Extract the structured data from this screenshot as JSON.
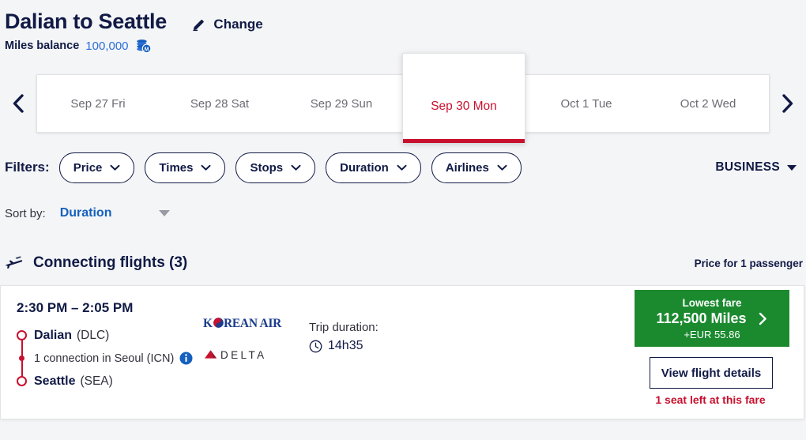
{
  "header": {
    "route_title": "Dalian to Seattle",
    "change_label": "Change",
    "miles_label": "Miles balance",
    "miles_value": "100,000"
  },
  "date_strip": {
    "prev_label": "previous dates",
    "next_label": "next dates",
    "tabs": [
      {
        "label": "Sep 27 Fri",
        "selected": false
      },
      {
        "label": "Sep 28 Sat",
        "selected": false
      },
      {
        "label": "Sep 29 Sun",
        "selected": false
      },
      {
        "label": "Sep 30 Mon",
        "selected": true
      },
      {
        "label": "Oct 1 Tue",
        "selected": false
      },
      {
        "label": "Oct 2 Wed",
        "selected": false
      }
    ]
  },
  "filters": {
    "label": "Filters:",
    "pills": [
      {
        "label": "Price"
      },
      {
        "label": "Times"
      },
      {
        "label": "Stops"
      },
      {
        "label": "Duration"
      },
      {
        "label": "Airlines"
      }
    ],
    "cabin": "BUSINESS"
  },
  "sort": {
    "label": "Sort by:",
    "value": "Duration"
  },
  "section": {
    "title": "Connecting flights (3)",
    "price_note": "Price for 1 passenger"
  },
  "flight": {
    "times": "2:30 PM – 2:05 PM",
    "origin_city": "Dalian",
    "origin_code": "(DLC)",
    "connection": "1 connection in Seoul (ICN)",
    "destination_city": "Seattle",
    "destination_code": "(SEA)",
    "airline_1": "KOREAN AIR",
    "airline_2": "DELTA",
    "duration_label": "Trip duration:",
    "duration_value": "14h35",
    "fare_top": "Lowest fare",
    "fare_miles": "112,500 Miles",
    "fare_sub": "+EUR 55.86",
    "details_label": "View flight details",
    "seat_warning": "1 seat left at this fare"
  },
  "colors": {
    "navy": "#111a45",
    "red": "#c8102e",
    "green": "#1b8a2f",
    "blue": "#1560bd",
    "page_bg": "#f4f5f7"
  }
}
